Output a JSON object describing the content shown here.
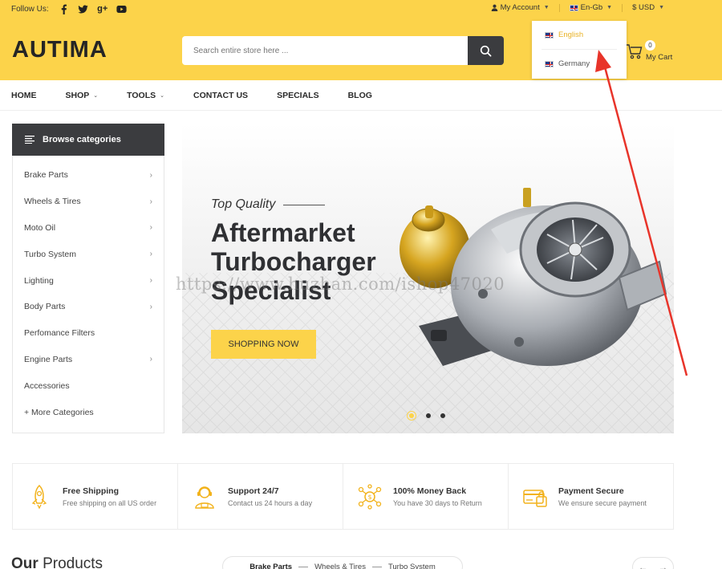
{
  "topbar": {
    "follow_label": "Follow Us:",
    "social": [
      "facebook-icon",
      "twitter-icon",
      "google-plus-icon",
      "youtube-icon"
    ],
    "google_plus_glyph": "g+",
    "account_label": "My Account",
    "language_label": "En-Gb",
    "currency_label": "$ USD"
  },
  "brand": {
    "logo": "AUTIMA"
  },
  "search": {
    "placeholder": "Search entire store here ..."
  },
  "cart": {
    "count": "0",
    "label": "My Cart"
  },
  "language_dropdown": {
    "options": [
      "English",
      "Germany"
    ],
    "selected": "English"
  },
  "nav": {
    "items": [
      "HOME",
      "SHOP",
      "TOOLS",
      "CONTACT US",
      "SPECIALS",
      "BLOG"
    ]
  },
  "categories": {
    "heading": "Browse categories",
    "items": [
      "Brake Parts",
      "Wheels & Tires",
      "Moto Oil",
      "Turbo System",
      "Lighting",
      "Body Parts",
      "Perfomance Filters",
      "Engine Parts",
      "Accessories",
      "+ More Categories"
    ]
  },
  "banner": {
    "kicker": "Top Quality",
    "title_line1": "Aftermarket",
    "title_line2": "Turbocharger",
    "title_line3": "Specialist",
    "cta": "SHOPPING NOW",
    "slides": 3,
    "active_slide": 1
  },
  "watermark": "https://www.huzhan.com/ishop47020",
  "features": [
    {
      "title": "Free Shipping",
      "subtitle": "Free shipping on all US order",
      "icon": "rocket-icon"
    },
    {
      "title": "Support 24/7",
      "subtitle": "Contact us 24 hours a day",
      "icon": "support-agent-icon"
    },
    {
      "title": "100% Money Back",
      "subtitle": "You have 30 days to Return",
      "icon": "money-back-icon"
    },
    {
      "title": "Payment Secure",
      "subtitle": "We ensure secure payment",
      "icon": "secure-payment-icon"
    }
  ],
  "products": {
    "title_part1": "Our",
    "title_part2": "Products",
    "tabs": [
      "Brake Parts",
      "Wheels & Tires",
      "Turbo System"
    ]
  },
  "colors": {
    "accent": "#fcd34a",
    "dark": "#3b3c3f",
    "annotation": "#e8342a"
  }
}
